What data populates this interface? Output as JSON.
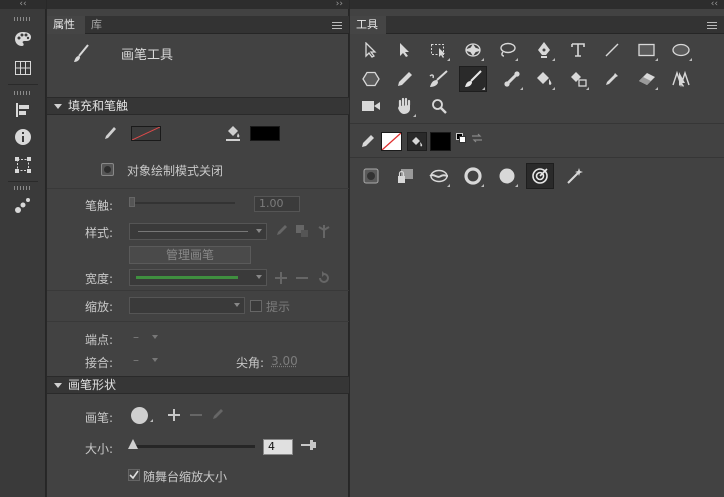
{
  "strip": {
    "collapse_glyph": "‹‹",
    "icons": [
      "palette-icon",
      "swatches-grid-icon",
      "align-icon",
      "info-icon",
      "transform-icon",
      "motion-presets-icon"
    ]
  },
  "props": {
    "collapse_glyph": "››",
    "tabs": [
      {
        "label": "属性"
      },
      {
        "label": "库"
      }
    ],
    "tool_name": "画笔工具",
    "fill_stroke": {
      "title": "填充和笔触",
      "object_draw": "对象绘制模式关闭",
      "stroke_color": "none",
      "fill_color": "#000000",
      "stroke_label": "笔触:",
      "stroke_value": "1.00",
      "style_label": "样式:",
      "manage_brush": "管理画笔",
      "width_label": "宽度:",
      "scale_label": "缩放:",
      "hint_label": "提示",
      "cap_label": "端点:",
      "join_label": "接合:",
      "miter_label": "尖角:",
      "miter_value": "3.00",
      "dash": "–"
    },
    "brush_shape": {
      "title": "画笔形状",
      "brush_label": "画笔:",
      "size_label": "大小:",
      "size_value": "4",
      "size_fraction": 0.02,
      "scale_with_stage": "随舞台缩放大小",
      "scale_with_stage_checked": true
    }
  },
  "tools": {
    "collapse_glyph": "‹‹",
    "tab": "工具",
    "row1": [
      "selection-tool-icon",
      "subselection-tool-icon",
      "free-transform-tool-icon",
      "3d-rotation-tool-icon",
      "lasso-tool-icon",
      "pen-tool-icon",
      "text-tool-icon",
      "line-tool-icon",
      "rectangle-tool-icon",
      "oval-tool-icon"
    ],
    "row2": [
      "polystar-tool-icon",
      "pencil-tool-icon",
      "brush-tool-icon",
      "paint-brush-tool-icon",
      "bone-tool-icon",
      "paint-bucket-tool-icon",
      "ink-bottle-tool-icon",
      "eyedropper-tool-icon",
      "eraser-tool-icon",
      "width-tool-icon"
    ],
    "row3": [
      "camera-tool-icon",
      "hand-tool-icon",
      "zoom-tool-icon"
    ],
    "active_tool": "paint-brush-tool-icon",
    "stroke_color": "none",
    "fill_color": "#000000"
  }
}
